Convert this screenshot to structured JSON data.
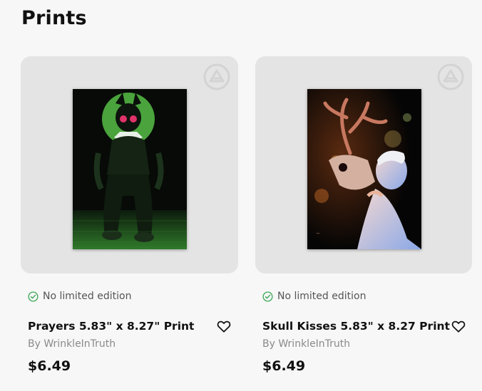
{
  "section": {
    "title": "Prints"
  },
  "products": [
    {
      "edition": "No limited edition",
      "title": "Prayers 5.83\" x 8.27\" Print",
      "author": "By WrinkleInTruth",
      "price": "$6.49",
      "art_icon": "nun-gasmask-artwork"
    },
    {
      "edition": "No limited edition",
      "title": "Skull Kisses 5.83\" x 8.27 Print",
      "author": "By WrinkleInTruth",
      "price": "$6.49",
      "art_icon": "skull-kiss-artwork"
    }
  ],
  "colors": {
    "check_green": "#3aa655",
    "badge_grey": "#d3d3d3",
    "thumb_bg": "#e4e4e4"
  }
}
